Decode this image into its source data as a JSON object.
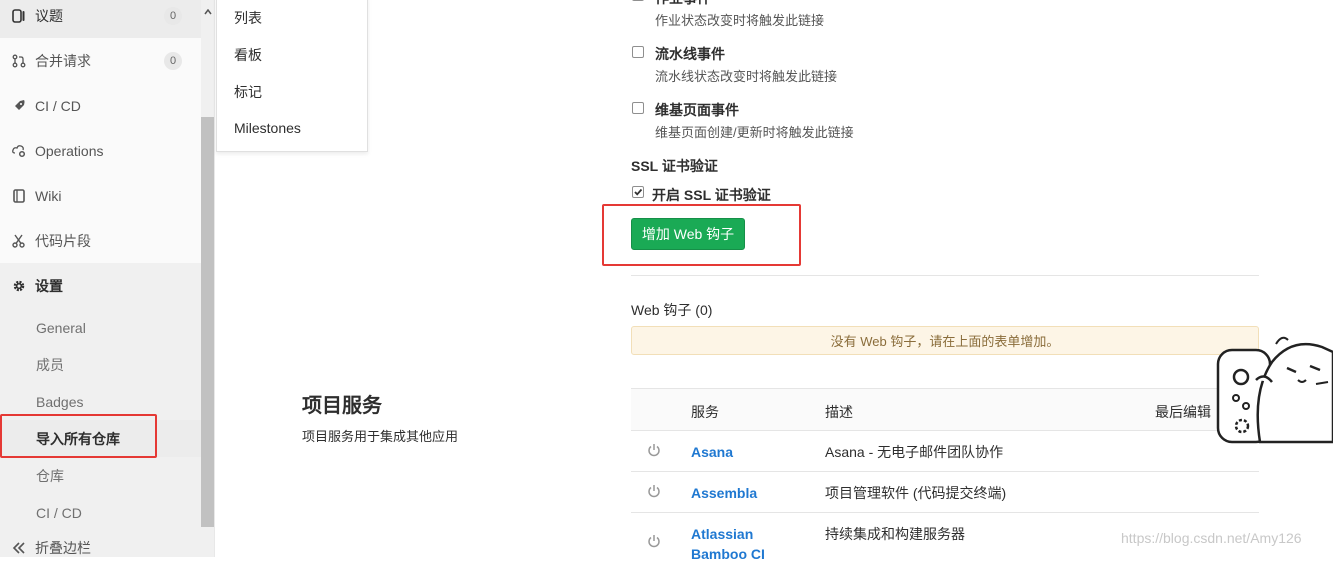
{
  "sidebar": {
    "items": [
      {
        "name": "issues",
        "label": "议题",
        "count": "0",
        "icon": "issues-icon"
      },
      {
        "name": "merge-requests",
        "label": "合并请求",
        "count": "0",
        "icon": "merge-request-icon"
      },
      {
        "name": "ci-cd",
        "label": "CI / CD",
        "icon": "rocket-icon"
      },
      {
        "name": "operations",
        "label": "Operations",
        "icon": "cloud-gear-icon"
      },
      {
        "name": "wiki",
        "label": "Wiki",
        "icon": "book-icon"
      },
      {
        "name": "snippets",
        "label": "代码片段",
        "icon": "scissors-icon"
      },
      {
        "name": "settings",
        "label": "设置",
        "icon": "gear-icon"
      }
    ],
    "settings_sub": [
      "General",
      "成员",
      "Badges",
      "导入所有仓库",
      "仓库",
      "CI / CD"
    ],
    "collapse_label": "折叠边栏"
  },
  "dropdown": {
    "items": [
      "列表",
      "看板",
      "标记",
      "Milestones"
    ]
  },
  "events": [
    {
      "title": "作业事件",
      "desc": "作业状态改变时将触发此链接"
    },
    {
      "title": "流水线事件",
      "desc": "流水线状态改变时将触发此链接"
    },
    {
      "title": "维基页面事件",
      "desc": "维基页面创建/更新时将触发此链接"
    }
  ],
  "ssl": {
    "heading": "SSL 证书验证",
    "checkbox_label": "开启 SSL 证书验证"
  },
  "add_hook_button": "增加 Web 钩子",
  "hooks": {
    "heading": "Web 钩子 (0)",
    "empty": "没有 Web 钩子，请在上面的表单增加。"
  },
  "services": {
    "title": "项目服务",
    "desc": "项目服务用于集成其他应用",
    "columns": [
      "服务",
      "描述",
      "最后编辑"
    ],
    "rows": [
      {
        "name": "Asana",
        "desc": "Asana - 无电子邮件团队协作"
      },
      {
        "name": "Assembla",
        "desc": "项目管理软件 (代码提交终端)"
      },
      {
        "name": "Atlassian Bamboo CI",
        "desc": "持续集成和构建服务器"
      }
    ]
  },
  "watermark": "https://blog.csdn.net/Amy126",
  "colors": {
    "accent_green": "#1aaa55",
    "link_blue": "#1f78d1",
    "highlight_red": "#e53935"
  }
}
